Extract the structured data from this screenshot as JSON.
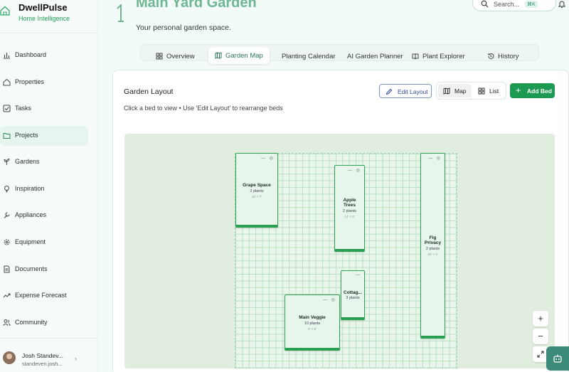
{
  "brand": {
    "name": "DwellPulse",
    "subtitle": "Home Intelligence"
  },
  "sidebar": {
    "items": [
      {
        "label": "Dashboard",
        "icon": "bar-chart-icon"
      },
      {
        "label": "Properties",
        "icon": "home-icon"
      },
      {
        "label": "Tasks",
        "icon": "checkbox-icon"
      },
      {
        "label": "Projects",
        "icon": "folder-icon",
        "active": true
      },
      {
        "label": "Gardens",
        "icon": "sprout-icon"
      },
      {
        "label": "Inspiration",
        "icon": "lightbulb-icon"
      },
      {
        "label": "Appliances",
        "icon": "wrench-icon"
      },
      {
        "label": "Equipment",
        "icon": "gear-icon"
      },
      {
        "label": "Documents",
        "icon": "document-icon"
      },
      {
        "label": "Expense Forecast",
        "icon": "trend-icon"
      },
      {
        "label": "Community",
        "icon": "users-icon"
      }
    ]
  },
  "user": {
    "name": "Josh Standev...",
    "email": "standeven.josh..."
  },
  "header": {
    "title": "Main Yard Garden",
    "subtitle": "Your personal garden space.",
    "search_placeholder": "Search...",
    "search_shortcut": "⌘K"
  },
  "tabs": [
    {
      "label": "Overview"
    },
    {
      "label": "Garden Map",
      "active": true
    },
    {
      "label": "Planting Calendar"
    },
    {
      "label": "AI Garden Planner"
    },
    {
      "label": "Plant Explorer"
    },
    {
      "label": "History"
    }
  ],
  "card": {
    "title": "Garden Layout",
    "hint": "Click a bed to view • Use 'Edit Layout' to rearrange beds",
    "edit_label": "Edit Layout",
    "map_label": "Map",
    "list_label": "List",
    "add_label": "Add Bed"
  },
  "beds": [
    {
      "name": "Grape Space",
      "count": "2 plants",
      "size": "12' × 7'"
    },
    {
      "name": "Apple Trees",
      "count": "2 plants",
      "size": "14' × 6'"
    },
    {
      "name": "Fig Privacy",
      "count": "2 plants",
      "size": "20' × 4'"
    },
    {
      "name": "Cottag...",
      "count": "3 plants",
      "size": ""
    },
    {
      "name": "Main Veggie",
      "count": "10 plants",
      "size": "8' × 8'"
    }
  ],
  "zoom": {
    "in": "+",
    "out": "−"
  },
  "colors": {
    "accent": "#1d9a52",
    "active_bg": "#e6f6ef",
    "bed_border": "#2fa559"
  }
}
